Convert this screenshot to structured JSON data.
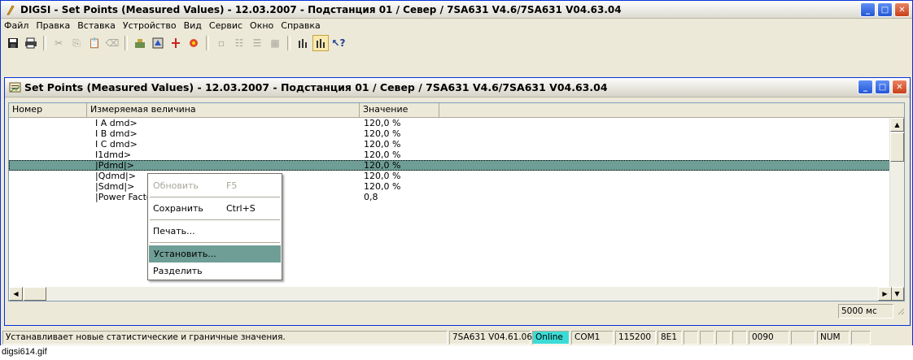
{
  "window": {
    "title": "DIGSI - Set Points (Measured Values) - 12.03.2007 - Подстанция 01 / Север / 7SA631 V4.6/7SA631 V04.63.04"
  },
  "menu": [
    "Файл",
    "Правка",
    "Вставка",
    "Устройство",
    "Вид",
    "Сервис",
    "Окно",
    "Справка"
  ],
  "toolbar": [
    "save-icon",
    "print-icon",
    "cut-icon",
    "copy-icon",
    "paste-icon",
    "delete-icon",
    "device-icon",
    "properties-icon",
    "update-icon",
    "transfer-icon",
    "list-small-icon",
    "list-icon",
    "details-icon",
    "grid-icon",
    "chart-icon",
    "chart-active-icon",
    "help-cursor-icon"
  ],
  "child_window": {
    "title": "Set Points (Measured Values) - 12.03.2007 - Подстанция 01 / Север / 7SA631 V4.6/7SA631 V04.63.04",
    "columns": [
      "Номер",
      "Измеряемая величина",
      "Значение"
    ],
    "rows": [
      {
        "number": "",
        "name": "I A dmd>",
        "value": "120,0 %"
      },
      {
        "number": "",
        "name": "I B dmd>",
        "value": "120,0 %"
      },
      {
        "number": "",
        "name": "I C dmd>",
        "value": "120,0 %"
      },
      {
        "number": "",
        "name": "I1dmd>",
        "value": "120,0 %"
      },
      {
        "number": "",
        "name": "|Pdmd|>",
        "value": "120,0 %"
      },
      {
        "number": "",
        "name": "|Qdmd|>",
        "value": "120,0 %"
      },
      {
        "number": "",
        "name": "|Sdmd|>",
        "value": "120,0 %"
      },
      {
        "number": "",
        "name": "|Power Facto",
        "value": "0,8"
      }
    ],
    "selected_row": 4,
    "status_interval": "5000 мс"
  },
  "context_menu": [
    {
      "label": "Обновить",
      "key": "F5",
      "enabled": false
    },
    {
      "sep": true
    },
    {
      "label": "Сохранить",
      "key": "Ctrl+S",
      "enabled": true
    },
    {
      "sep": true
    },
    {
      "label": "Печать...",
      "key": "",
      "enabled": true
    },
    {
      "sep": true
    },
    {
      "label": "Установить...",
      "key": "",
      "enabled": true,
      "highlight": true
    },
    {
      "label": "Разделить",
      "key": "",
      "enabled": true
    }
  ],
  "statusbar": {
    "message": "Устанавливает новые статистические и граничные значения.",
    "device": "7SA631 V04.61.06",
    "online": "Online",
    "port": "COM1",
    "baud": "115200",
    "format": "8E1",
    "address": "0090",
    "num": "NUM"
  },
  "caption": "digsi614.gif",
  "colors": {
    "selection": "#6e9e95",
    "online_bg": "#3cdcd6",
    "close_button": "#c8401a"
  }
}
